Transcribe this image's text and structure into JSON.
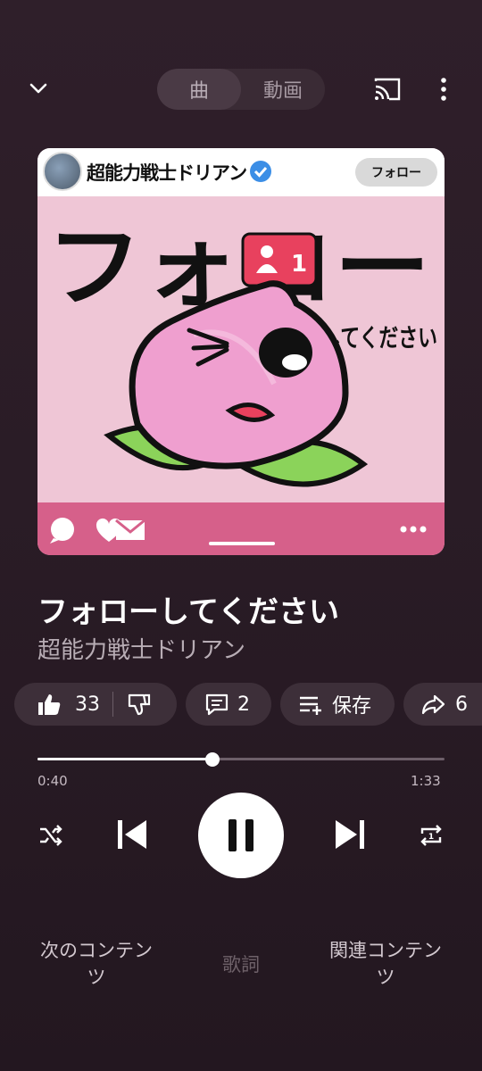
{
  "header": {
    "segment": [
      "曲",
      "動画"
    ],
    "active_segment": "曲"
  },
  "artwork": {
    "channel_name": "超能力戦士ドリアン",
    "follow_label": "フォロー",
    "headline": "フォロー",
    "subline": "してください",
    "badge_count": "1"
  },
  "track": {
    "title": "フォローしてください",
    "artist": "超能力戦士ドリアン"
  },
  "actions": {
    "likes": "33",
    "comments": "2",
    "save_label": "保存",
    "shares": "6"
  },
  "progress": {
    "current": "0:40",
    "total": "1:33",
    "fraction": 0.43
  },
  "tabs": {
    "next": "次のコンテンツ",
    "lyrics": "歌詞",
    "related": "関連コンテンツ"
  },
  "colors": {
    "background": "#2a1c26",
    "chip": "#3d2f39",
    "art_pink": "#efc6d6",
    "art_bar": "#d6608a"
  }
}
